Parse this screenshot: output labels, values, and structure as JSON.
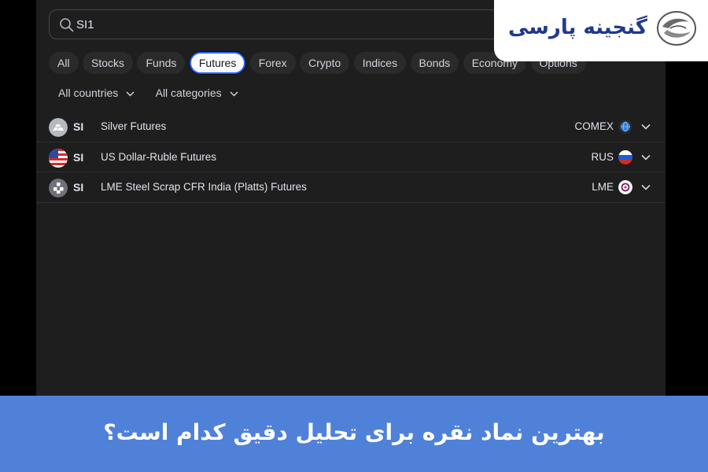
{
  "search": {
    "value": "SI1"
  },
  "tabs": [
    {
      "label": "All"
    },
    {
      "label": "Stocks"
    },
    {
      "label": "Funds"
    },
    {
      "label": "Futures",
      "active": true
    },
    {
      "label": "Forex"
    },
    {
      "label": "Crypto"
    },
    {
      "label": "Indices"
    },
    {
      "label": "Bonds"
    },
    {
      "label": "Economy"
    },
    {
      "label": "Options"
    }
  ],
  "filters": {
    "countries": "All countries",
    "categories": "All categories"
  },
  "results": [
    {
      "symbol": "SI",
      "description": "Silver Futures",
      "exchange": "COMEX",
      "logo": "silver-bars-icon",
      "flag": "globe-icon"
    },
    {
      "symbol": "SI",
      "description": "US Dollar-Ruble Futures",
      "exchange": "RUS",
      "logo": "us-flag-icon",
      "flag": "russia-flag-icon"
    },
    {
      "symbol": "SI",
      "description": "LME Steel Scrap CFR India (Platts) Futures",
      "exchange": "LME",
      "logo": "steel-blocks-icon",
      "flag": "lme-logo-icon"
    }
  ],
  "brand": {
    "name": "گنجینه پارسی"
  },
  "banner": {
    "text": "بهترین نماد نقره برای تحلیل دقیق کدام است؟"
  },
  "colors": {
    "accent": "#2962ff",
    "banner": "#4f81d9",
    "brand_text": "#1f3a8a",
    "panel": "#1e1e1e"
  }
}
